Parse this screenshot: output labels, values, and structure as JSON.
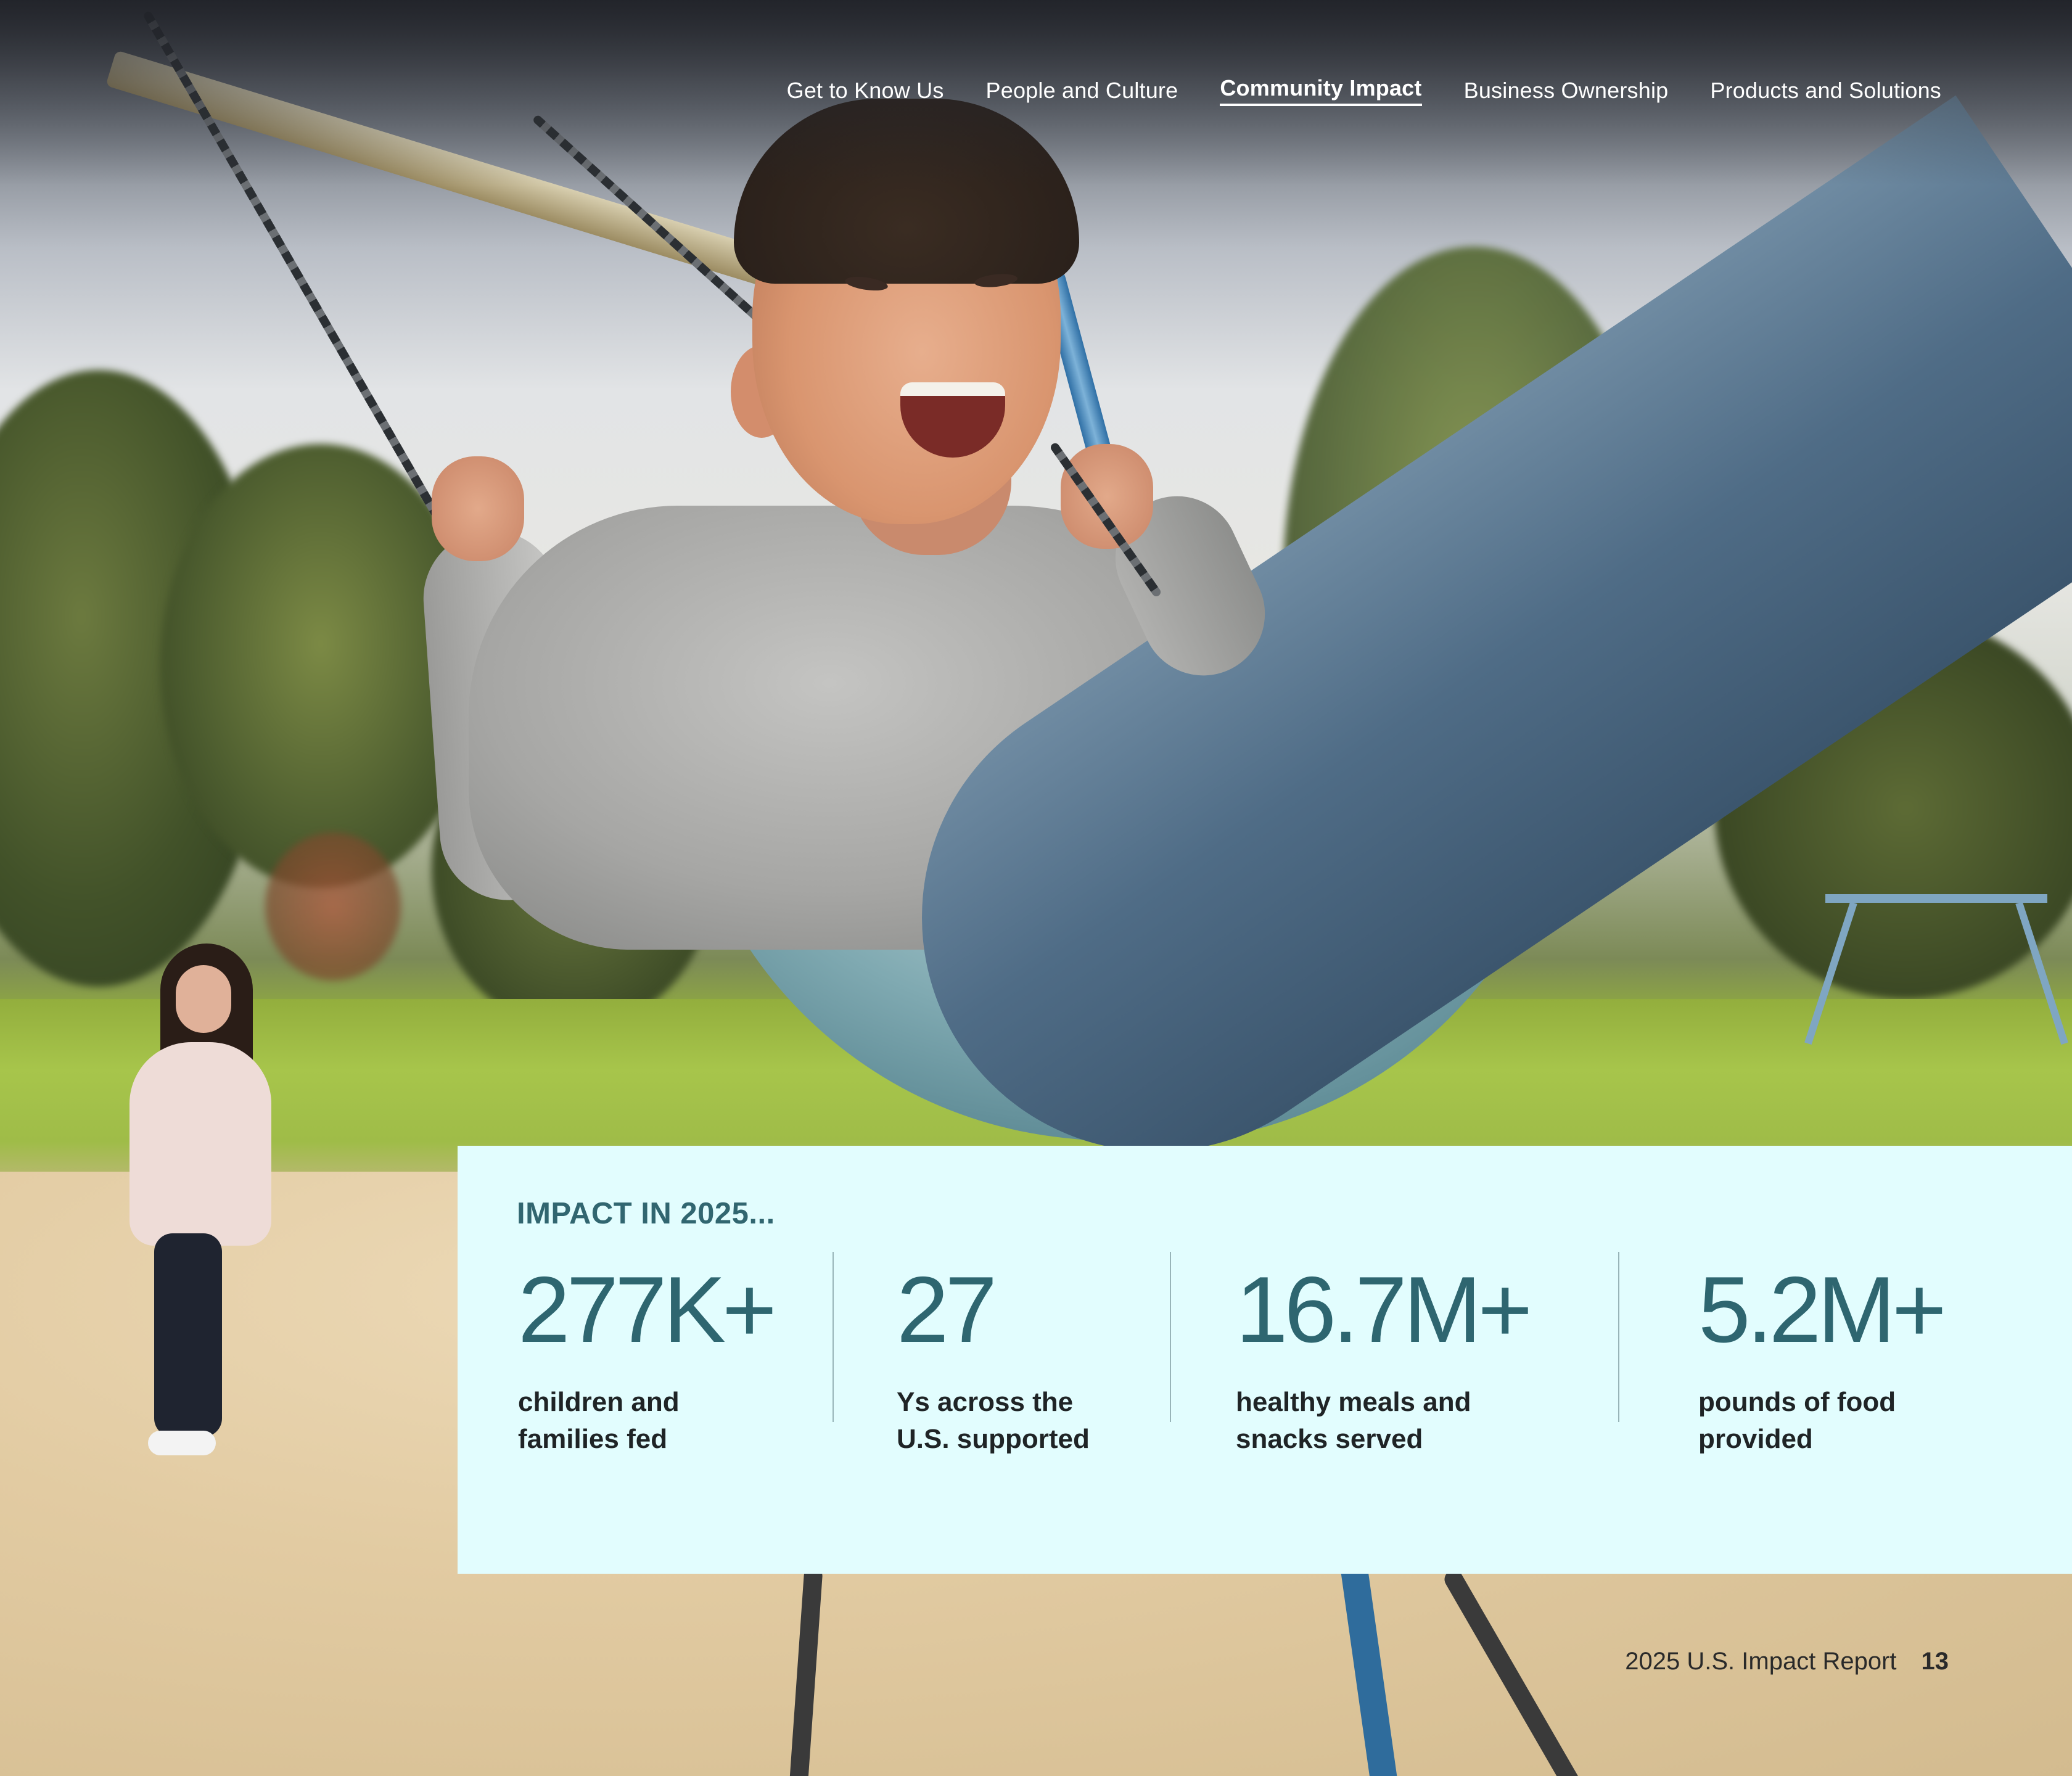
{
  "nav": {
    "items": [
      {
        "label": "Get to Know Us",
        "active": false
      },
      {
        "label": "People and Culture",
        "active": false
      },
      {
        "label": "Community Impact",
        "active": true
      },
      {
        "label": "Business Ownership",
        "active": false
      },
      {
        "label": "Products and Solutions",
        "active": false
      }
    ]
  },
  "impact": {
    "heading": "IMPACT IN 2025...",
    "stats": [
      {
        "value": "277K+",
        "label": "children and\nfamilies fed"
      },
      {
        "value": "27",
        "label": "Ys across the\nU.S. supported"
      },
      {
        "value": "16.7M+",
        "label": "healthy meals and\nsnacks served"
      },
      {
        "value": "5.2M+",
        "label": "pounds of food\nprovided"
      }
    ]
  },
  "footer": {
    "report_title": "2025 U.S. Impact Report",
    "page_number": "13"
  },
  "colors": {
    "panel_background": "#e2fdfe",
    "stat_value": "#2e6670",
    "heading": "#316670",
    "label": "#1f2426"
  },
  "photo": {
    "icon": "hero-photo-boy-on-swing"
  }
}
